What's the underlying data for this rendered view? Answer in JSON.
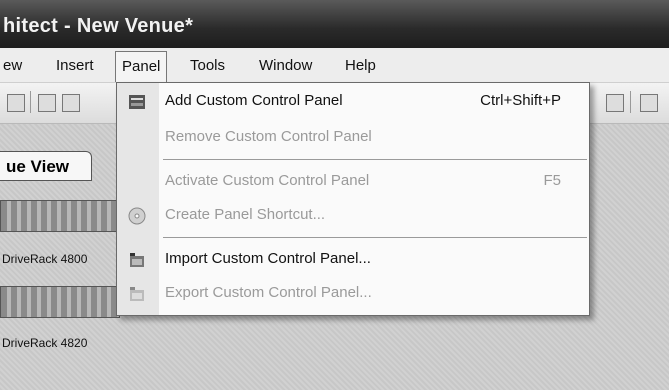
{
  "window": {
    "title": "hitect - New Venue*"
  },
  "menubar": {
    "items": [
      "ew",
      "Insert",
      "Panel",
      "Tools",
      "Window",
      "Help"
    ]
  },
  "workspace": {
    "tab_label": "ue View",
    "devices": [
      {
        "label": "DriveRack 4800"
      },
      {
        "label": "DriveRack 4820"
      }
    ]
  },
  "dropdown": {
    "items": [
      {
        "label": "Add Custom Control Panel",
        "shortcut": "Ctrl+Shift+P",
        "icon": "panel-icon"
      },
      {
        "label": "Remove Custom Control Panel",
        "shortcut": "",
        "icon": ""
      },
      {
        "label": "Activate Custom Control Panel",
        "shortcut": "F5",
        "icon": ""
      },
      {
        "label": "Create Panel Shortcut...",
        "shortcut": "",
        "icon": "cd-icon"
      },
      {
        "label": "Import Custom Control Panel...",
        "shortcut": "",
        "icon": "import-icon"
      },
      {
        "label": "Export Custom Control Panel...",
        "shortcut": "",
        "icon": "export-icon"
      }
    ]
  }
}
